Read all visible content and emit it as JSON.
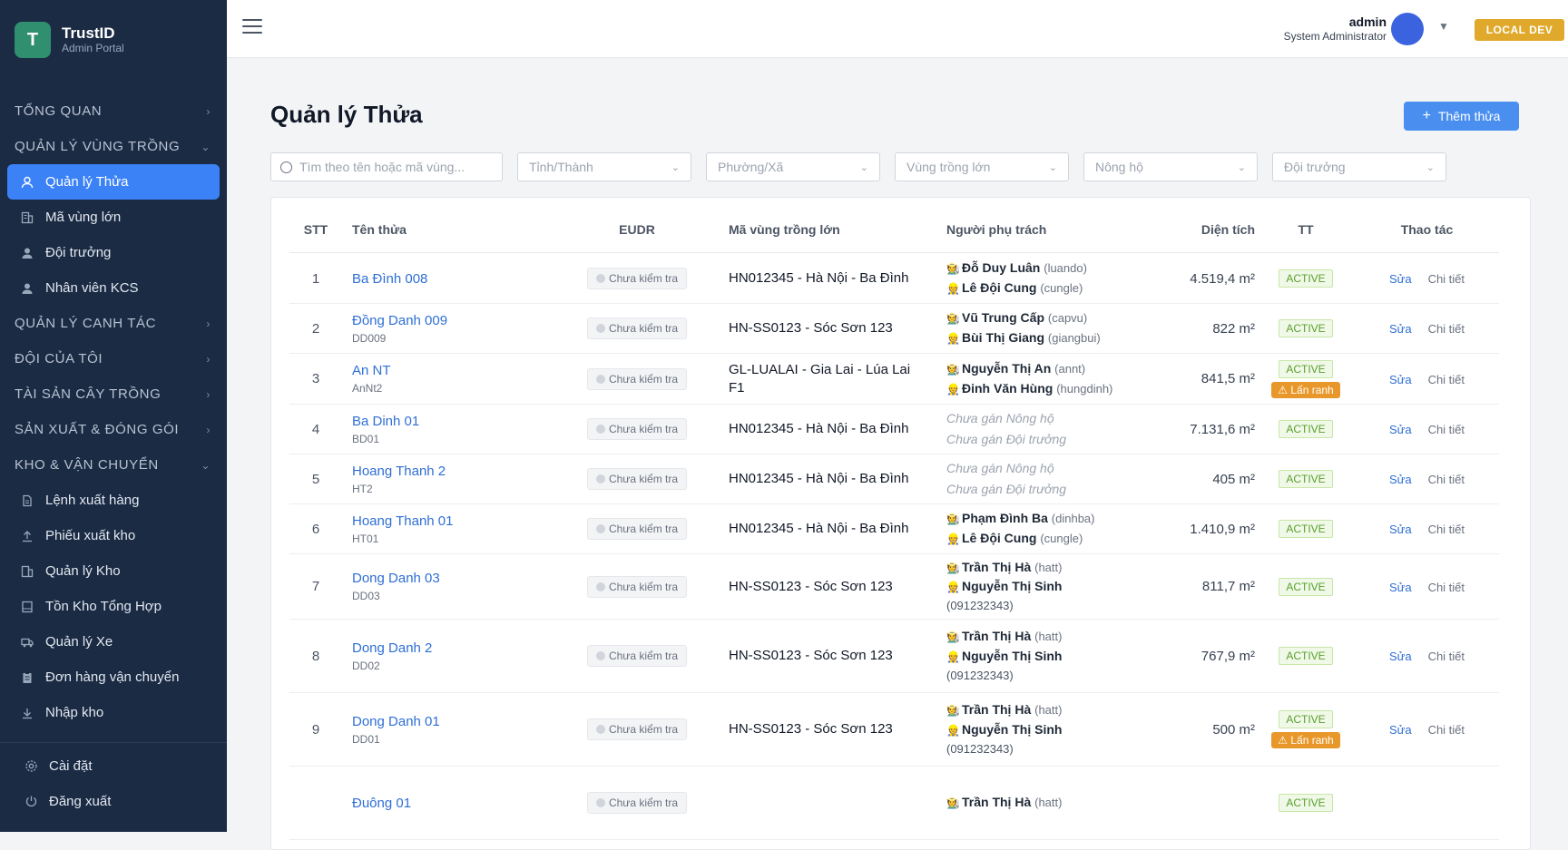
{
  "brand": {
    "logo_letter": "T",
    "title": "TrustID",
    "subtitle": "Admin Portal"
  },
  "sidebar": {
    "sections": [
      {
        "label": "TỔNG QUAN",
        "expanded": false
      },
      {
        "label": "QUẢN LÝ VÙNG TRỒNG",
        "expanded": true,
        "items": [
          {
            "label": "Quản lý Thửa",
            "icon": "user-icon",
            "active": true
          },
          {
            "label": "Mã vùng lớn",
            "icon": "building-icon",
            "active": false
          },
          {
            "label": "Đội trưởng",
            "icon": "user-icon",
            "active": false
          },
          {
            "label": "Nhân viên KCS",
            "icon": "user-icon",
            "active": false
          }
        ]
      },
      {
        "label": "QUẢN LÝ CANH TÁC",
        "expanded": false
      },
      {
        "label": "ĐỘI CỦA TÔI",
        "expanded": false
      },
      {
        "label": "TÀI SẢN CÂY TRỒNG",
        "expanded": false
      },
      {
        "label": "SẢN XUẤT & ĐÓNG GÓI",
        "expanded": false
      },
      {
        "label": "KHO & VẬN CHUYỂN",
        "expanded": true,
        "items": [
          {
            "label": "Lệnh xuất hàng",
            "icon": "document-icon"
          },
          {
            "label": "Phiếu xuất kho",
            "icon": "upload-icon"
          },
          {
            "label": "Quản lý Kho",
            "icon": "building-icon"
          },
          {
            "label": "Tồn Kho Tổng Hợp",
            "icon": "inventory-icon"
          },
          {
            "label": "Quản lý Xe",
            "icon": "truck-icon"
          },
          {
            "label": "Đơn hàng vận chuyển",
            "icon": "clipboard-icon"
          },
          {
            "label": "Nhập kho",
            "icon": "download-icon"
          }
        ]
      }
    ],
    "bottom": [
      {
        "label": "Cài đặt",
        "icon": "gear-icon"
      },
      {
        "label": "Đăng xuất",
        "icon": "power-icon"
      }
    ]
  },
  "header": {
    "user_name": "admin",
    "user_role": "System Administrator",
    "env_badge": "LOCAL DEV",
    "avatar_color": "#3b63e0"
  },
  "page": {
    "title": "Quản lý Thửa",
    "add_button": "Thêm thửa"
  },
  "filters": {
    "search_placeholder": "Tìm theo tên hoặc mã vùng...",
    "province": "Tỉnh/Thành",
    "ward": "Phường/Xã",
    "region": "Vùng trồng lớn",
    "farmer": "Nông hộ",
    "leader": "Đội trưởng"
  },
  "table": {
    "headers": {
      "stt": "STT",
      "name": "Tên thửa",
      "eudr": "EUDR",
      "vung": "Mã vùng trồng lớn",
      "nguoi": "Người phụ trách",
      "dt": "Diện tích",
      "tt": "TT",
      "act": "Thao tác"
    },
    "eudr_label": "Chưa kiểm tra",
    "edit_label": "Sửa",
    "detail_label": "Chi tiết",
    "unassigned_farmer": "Chưa gán Nông hộ",
    "unassigned_leader": "Chưa gán Đội trưởng",
    "warn_label": "Lấn ranh",
    "rows": [
      {
        "stt": "1",
        "name": "Ba Đình 008",
        "code": "",
        "vung": "HN012345 - Hà Nội - Ba Đình",
        "farmer": "Đỗ Duy Luân",
        "farmer_user": "(luando)",
        "leader": "Lê Đội Cung",
        "leader_user": "(cungle)",
        "phone": "",
        "area": "4.519,4 m²",
        "status": "ACTIVE",
        "warn": false
      },
      {
        "stt": "2",
        "name": "Đồng Danh 009",
        "code": "DD009",
        "vung": "HN-SS0123 - Sóc Sơn 123",
        "farmer": "Vũ Trung Cấp",
        "farmer_user": "(capvu)",
        "leader": "Bùi Thị Giang",
        "leader_user": "(giangbui)",
        "phone": "",
        "area": "822 m²",
        "status": "ACTIVE",
        "warn": false
      },
      {
        "stt": "3",
        "name": "An NT",
        "code": "AnNt2",
        "vung": "GL-LUALAI - Gia Lai - Lúa Lai F1",
        "farmer": "Nguyễn Thị An",
        "farmer_user": "(annt)",
        "leader": "Đinh Văn Hùng",
        "leader_user": "(hungdinh)",
        "phone": "",
        "area": "841,5 m²",
        "status": "ACTIVE",
        "warn": true
      },
      {
        "stt": "4",
        "name": "Ba Dinh 01",
        "code": "BD01",
        "vung": "HN012345 - Hà Nội - Ba Đình",
        "farmer": "",
        "farmer_user": "",
        "leader": "",
        "leader_user": "",
        "phone": "",
        "area": "7.131,6 m²",
        "status": "ACTIVE",
        "warn": false
      },
      {
        "stt": "5",
        "name": "Hoang Thanh 2",
        "code": "HT2",
        "vung": "HN012345 - Hà Nội - Ba Đình",
        "farmer": "",
        "farmer_user": "",
        "leader": "",
        "leader_user": "",
        "phone": "",
        "area": "405 m²",
        "status": "ACTIVE",
        "warn": false
      },
      {
        "stt": "6",
        "name": "Hoang Thanh 01",
        "code": "HT01",
        "vung": "HN012345 - Hà Nội - Ba Đình",
        "farmer": "Phạm Đình Ba",
        "farmer_user": "(dinhba)",
        "leader": "Lê Đội Cung",
        "leader_user": "(cungle)",
        "phone": "",
        "area": "1.410,9 m²",
        "status": "ACTIVE",
        "warn": false
      },
      {
        "stt": "7",
        "name": "Dong Danh 03",
        "code": "DD03",
        "vung": "HN-SS0123 - Sóc Sơn 123",
        "farmer": "Trần Thị Hà",
        "farmer_user": "(hatt)",
        "leader": "Nguyễn Thị Sinh",
        "leader_user": "",
        "phone": "(091232343)",
        "area": "811,7 m²",
        "status": "ACTIVE",
        "warn": false
      },
      {
        "stt": "8",
        "name": "Dong Danh 2",
        "code": "DD02",
        "vung": "HN-SS0123 - Sóc Sơn 123",
        "farmer": "Trần Thị Hà",
        "farmer_user": "(hatt)",
        "leader": "Nguyễn Thị Sinh",
        "leader_user": "",
        "phone": "(091232343)",
        "area": "767,9 m²",
        "status": "ACTIVE",
        "warn": false
      },
      {
        "stt": "9",
        "name": "Dong Danh 01",
        "code": "DD01",
        "vung": "HN-SS0123 - Sóc Sơn 123",
        "farmer": "Trần Thị Hà",
        "farmer_user": "(hatt)",
        "leader": "Nguyễn Thị Sinh",
        "leader_user": "",
        "phone": "(091232343)",
        "area": "500 m²",
        "status": "ACTIVE",
        "warn": true
      },
      {
        "stt": "",
        "name": "Đuông 01",
        "code": "",
        "vung": "",
        "farmer": "Trần Thị Hà",
        "farmer_user": "(hatt)",
        "leader": "",
        "leader_user": "",
        "phone": "",
        "area": "",
        "status": "ACTIVE",
        "warn": false
      }
    ]
  }
}
